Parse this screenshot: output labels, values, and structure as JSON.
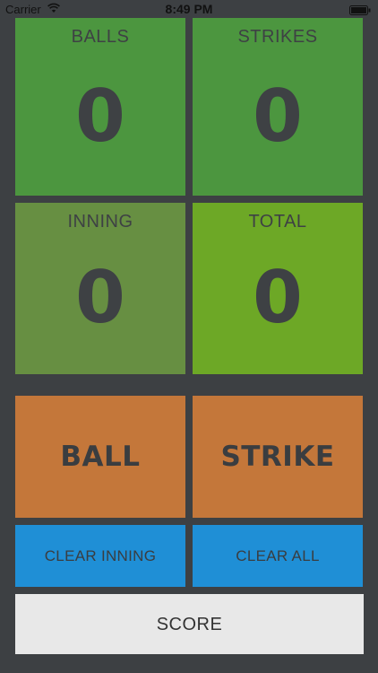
{
  "status_bar": {
    "carrier": "Carrier",
    "time": "8:49 PM",
    "wifi_icon": "wifi-icon",
    "battery_icon": "battery-icon"
  },
  "scoreboard": {
    "balls": {
      "label": "BALLS",
      "value": "0"
    },
    "strikes": {
      "label": "STRIKES",
      "value": "0"
    },
    "inning": {
      "label": "INNING",
      "value": "0"
    },
    "total": {
      "label": "TOTAL",
      "value": "0"
    }
  },
  "actions": {
    "ball_label": "BALL",
    "strike_label": "STRIKE",
    "clear_inning_label": "CLEAR INNING",
    "clear_all_label": "CLEAR ALL",
    "score_label": "SCORE"
  },
  "colors": {
    "background": "#3d4043",
    "balls_tile": "#4c963f",
    "strikes_tile": "#4c963f",
    "inning_tile": "#678f42",
    "total_tile": "#6da826",
    "orange_button": "#c4773a",
    "blue_button": "#1f8fd6",
    "score_button": "#e8e8e8"
  }
}
